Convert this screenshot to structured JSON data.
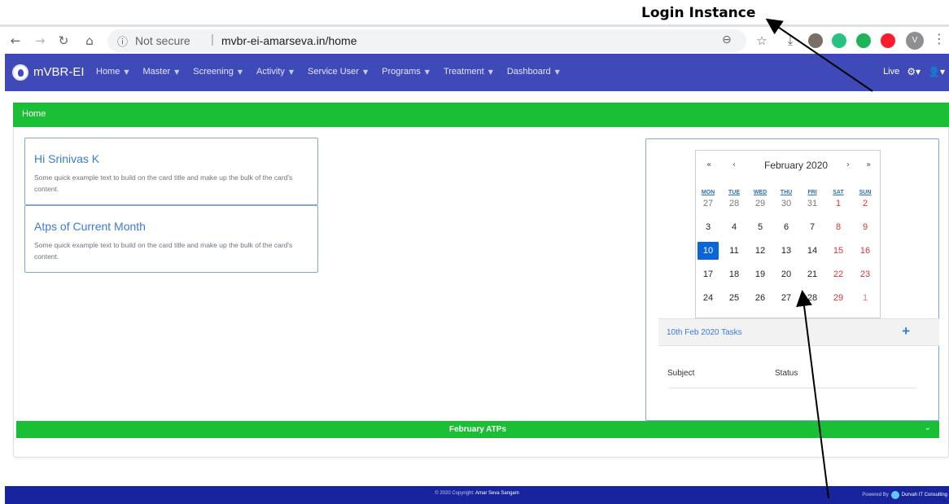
{
  "annotation": {
    "label": "Login Instance"
  },
  "browser": {
    "security_label": "Not secure",
    "url": "mvbr-ei-amarseva.in/home",
    "profile_initial": "V"
  },
  "navbar": {
    "brand": "mVBR-EI",
    "menu": [
      "Home",
      "Master",
      "Screening",
      "Activity",
      "Service User",
      "Programs",
      "Treatment",
      "Dashboard"
    ],
    "live_label": "Live"
  },
  "page": {
    "header": "Home"
  },
  "cards": [
    {
      "title": "Hi Srinivas K",
      "text": "Some quick example text to build on the card title and make up the bulk of the card's content."
    },
    {
      "title": "Atps of Current Month",
      "text": "Some quick example text to build on the card title and make up the bulk of the card's content."
    }
  ],
  "calendar": {
    "month_label": "February 2020",
    "nav": {
      "prev_year": "«",
      "prev_month": "‹",
      "next_month": "›",
      "next_year": "»"
    },
    "weekdays": [
      "MON",
      "TUE",
      "WED",
      "THU",
      "FRI",
      "SAT",
      "SUN"
    ],
    "weeks": [
      [
        "27",
        "28",
        "29",
        "30",
        "31",
        "1",
        "2"
      ],
      [
        "3",
        "4",
        "5",
        "6",
        "7",
        "8",
        "9"
      ],
      [
        "10",
        "11",
        "12",
        "13",
        "14",
        "15",
        "16"
      ],
      [
        "17",
        "18",
        "19",
        "20",
        "21",
        "22",
        "23"
      ],
      [
        "24",
        "25",
        "26",
        "27",
        "28",
        "29",
        "1"
      ]
    ],
    "selected": "10"
  },
  "tasks": {
    "title": "10th Feb 2020 Tasks",
    "add_label": "+",
    "columns": [
      "Subject",
      "Status"
    ]
  },
  "atp_bar": {
    "label": "February ATPs"
  },
  "footer": {
    "copyright_prefix": "© 2020 Copyright:",
    "copyright_org": "Amar Seva Sangam",
    "powered_prefix": "Powered By",
    "powered_org": "Durvah IT Consulting"
  },
  "colors": {
    "navbar": "#3f4ab8",
    "green": "#1bbf35",
    "footer": "#18239e",
    "selected_day": "#0a66d6",
    "link": "#3a7bd5"
  }
}
